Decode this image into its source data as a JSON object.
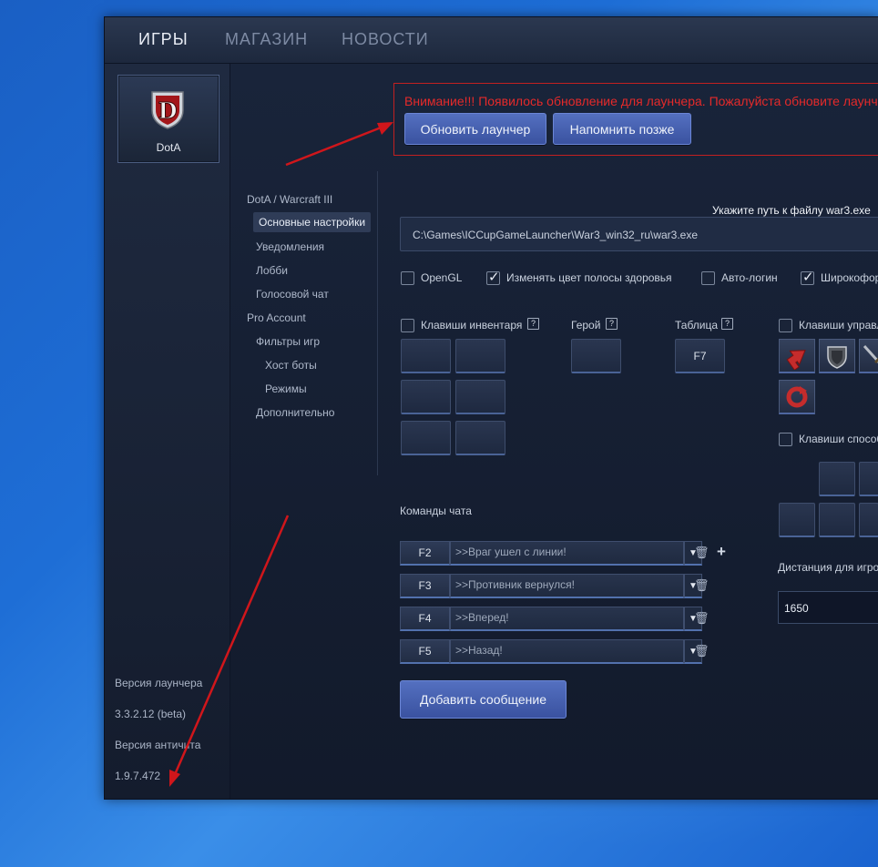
{
  "topnav": {
    "tabs": [
      {
        "label": "ИГРЫ",
        "active": true
      },
      {
        "label": "МАГАЗИН",
        "active": false
      },
      {
        "label": "НОВОСТИ",
        "active": false
      }
    ]
  },
  "game": {
    "name": "DotA",
    "icon": "dota-shield-logo"
  },
  "version": {
    "launcher_label": "Версия лаунчера",
    "launcher_value": "3.3.2.12 (beta)",
    "anticheat_label": "Версия античита",
    "anticheat_value": "1.9.7.472"
  },
  "notice": {
    "text": "Внимание!!! Появилось обновление для лаунчера. Пожалуйста обновите лаунчер",
    "update_button": "Обновить лаунчер",
    "remind_button": "Напомнить позже",
    "color": "#e52a2a"
  },
  "settings_nav": {
    "items": [
      {
        "label": "DotA / Warcraft III",
        "level": 0
      },
      {
        "label": "Основные настройки",
        "level": 1,
        "selected": true
      },
      {
        "label": "Уведомления",
        "level": 1
      },
      {
        "label": "Лобби",
        "level": 1
      },
      {
        "label": "Голосовой чат",
        "level": 1
      },
      {
        "label": "Pro Account",
        "level": 0
      },
      {
        "label": "Фильтры игр",
        "level": 1
      },
      {
        "label": "Хост боты",
        "level": 2
      },
      {
        "label": "Режимы",
        "level": 2
      },
      {
        "label": "Дополнительно",
        "level": 1
      }
    ]
  },
  "path": {
    "label": "Укажите путь к файлу war3.exe",
    "value": "C:\\Games\\ICCupGameLauncher\\War3_win32_ru\\war3.exe"
  },
  "options": [
    {
      "label": "OpenGL",
      "checked": false
    },
    {
      "label": "Изменять цвет полосы здоровья",
      "checked": true
    },
    {
      "label": "Авто-логин",
      "checked": false
    },
    {
      "label": "Широкоформатный",
      "checked": true
    }
  ],
  "hotkeys": {
    "inventory_label": "Клавиши инвентаря",
    "inventory_checked": false,
    "hero_label": "Герой",
    "table_label": "Таблица",
    "table_key": "F7",
    "control_label": "Клавиши управления",
    "control_checked": false,
    "abilities_label": "Клавиши способностей",
    "abilities_checked": false,
    "help_glyph": "?"
  },
  "chat": {
    "label": "Команды чата",
    "rows": [
      {
        "key": "F2",
        "message": ">>Враг ушел с линии!"
      },
      {
        "key": "F3",
        "message": ">>Противник вернулся!"
      },
      {
        "key": "F4",
        "message": ">>Вперед!"
      },
      {
        "key": "F5",
        "message": ">>Назад!"
      }
    ],
    "add_button": "Добавить сообщение"
  },
  "distance": {
    "label": "Дистанция для игрока",
    "value": "1650"
  },
  "colors": {
    "accent_button": "#4a63b3",
    "annotation_arrow": "#d0161b"
  }
}
